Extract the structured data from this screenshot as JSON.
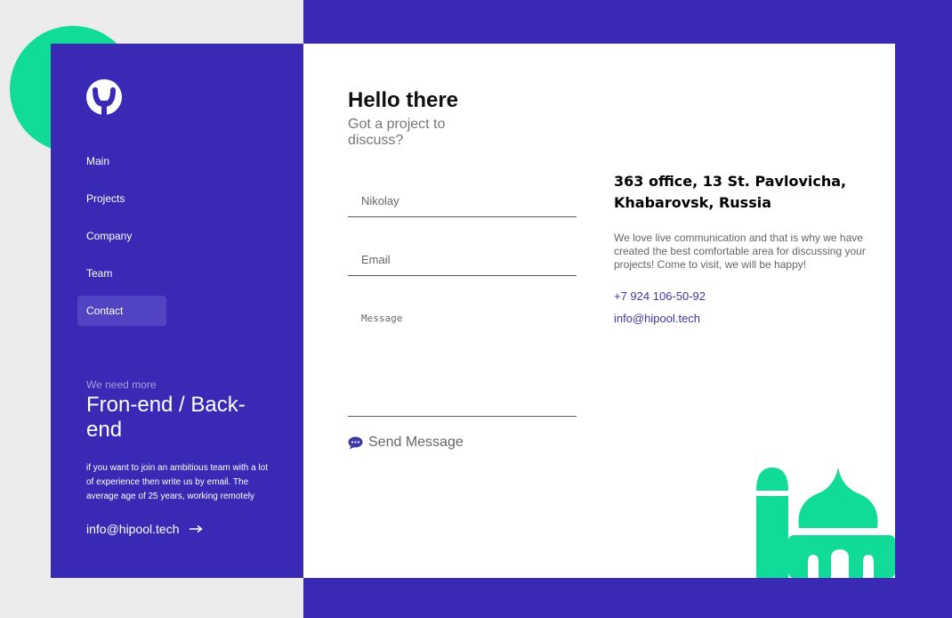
{
  "sidebar": {
    "nav": [
      "Main",
      "Projects",
      "Company",
      "Team",
      "Contact"
    ],
    "hire": {
      "kicker": "We need more",
      "title": "Fron-end / Back-end",
      "text": "if you want to join an ambitious team with a lot of experience then write us by email. The average age of 25 years, working remotely",
      "email": "info@hipool.tech"
    }
  },
  "greeting": {
    "title": "Hello there",
    "subtitle": "Got a project to discuss?"
  },
  "form": {
    "name_placeholder": "Nikolay",
    "email_placeholder": "Email",
    "message_placeholder": "Message",
    "send_label": "Send Message"
  },
  "info": {
    "address": "363 office, 13 St. Pavlovicha, Khabarovsk, Russia",
    "about": "We love live communication and that is why we have created the best comfortable area for discussing your projects! Come to visit, we will be happy!",
    "phone": "+7 924 106-50-92",
    "email": "info@hipool.tech"
  },
  "colors": {
    "brand": "#3a29b4",
    "accent": "#10dc98",
    "link": "#3d37a8"
  },
  "icons": {
    "logo": "hipool-logo-icon",
    "arrow": "arrow-right-icon",
    "send": "chat-bubble-icon",
    "illustration": "mosque-icon"
  }
}
